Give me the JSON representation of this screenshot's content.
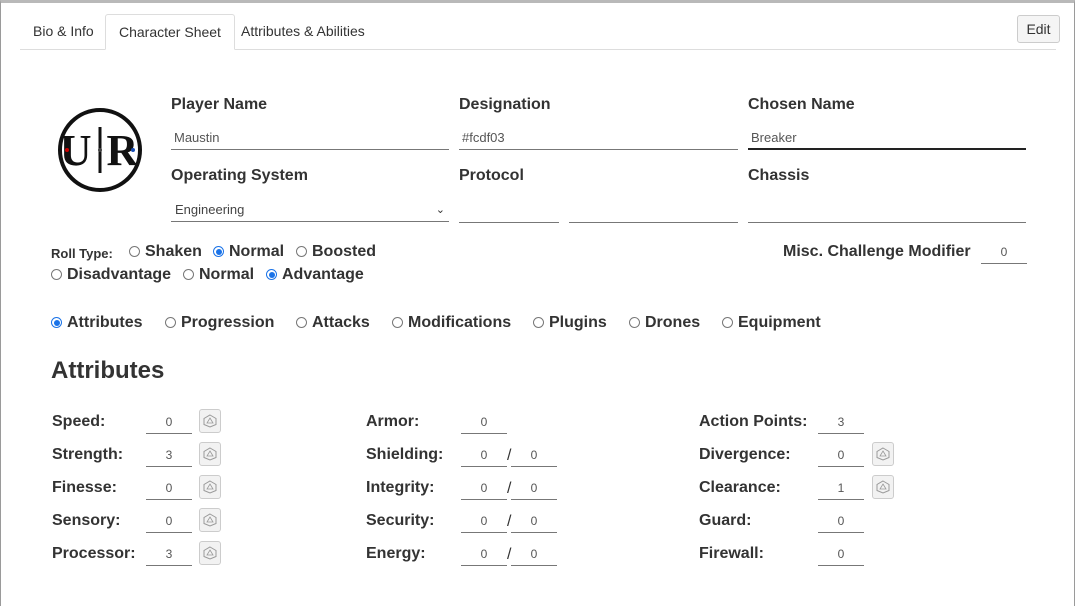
{
  "tabs": [
    "Bio & Info",
    "Character Sheet",
    "Attributes & Abilities"
  ],
  "active_tab": 1,
  "edit_label": "Edit",
  "header": {
    "player_name": {
      "label": "Player Name",
      "value": "Maustin"
    },
    "designation": {
      "label": "Designation",
      "value": "#fcdf03"
    },
    "chosen_name": {
      "label": "Chosen Name",
      "value": "Breaker"
    },
    "operating_system": {
      "label": "Operating System",
      "value": "Engineering"
    },
    "protocol": {
      "label": "Protocol",
      "value1": "",
      "value2": ""
    },
    "chassis": {
      "label": "Chassis",
      "value": ""
    }
  },
  "logo_text": "U·R",
  "roll_type": {
    "label": "Roll Type:",
    "options": [
      "Shaken",
      "Normal",
      "Boosted"
    ],
    "selected": "Normal",
    "options2": [
      "Disadvantage",
      "Normal",
      "Advantage"
    ],
    "selected2": "Advantage"
  },
  "misc": {
    "label": "Misc. Challenge Modifier",
    "value": "0"
  },
  "sections": {
    "options": [
      "Attributes",
      "Progression",
      "Attacks",
      "Modifications",
      "Plugins",
      "Drones",
      "Equipment"
    ],
    "selected": "Attributes"
  },
  "attributes_title": "Attributes",
  "col1": [
    {
      "label": "Speed:",
      "value": "0"
    },
    {
      "label": "Strength:",
      "value": "3"
    },
    {
      "label": "Finesse:",
      "value": "0"
    },
    {
      "label": "Sensory:",
      "value": "0"
    },
    {
      "label": "Processor:",
      "value": "3"
    }
  ],
  "col2": [
    {
      "label": "Armor:",
      "value": "0"
    },
    {
      "label": "Shielding:",
      "value": "0",
      "max": "0"
    },
    {
      "label": "Integrity:",
      "value": "0",
      "max": "0"
    },
    {
      "label": "Security:",
      "value": "0",
      "max": "0"
    },
    {
      "label": "Energy:",
      "value": "0",
      "max": "0"
    }
  ],
  "col3": [
    {
      "label": "Action Points:",
      "value": "3"
    },
    {
      "label": "Divergence:",
      "value": "0"
    },
    {
      "label": "Clearance:",
      "value": "1"
    },
    {
      "label": "Guard:",
      "value": "0"
    },
    {
      "label": "Firewall:",
      "value": "0"
    }
  ],
  "icons": {
    "dice": "d20-dice-icon",
    "chevron": "chevron-down-icon"
  }
}
